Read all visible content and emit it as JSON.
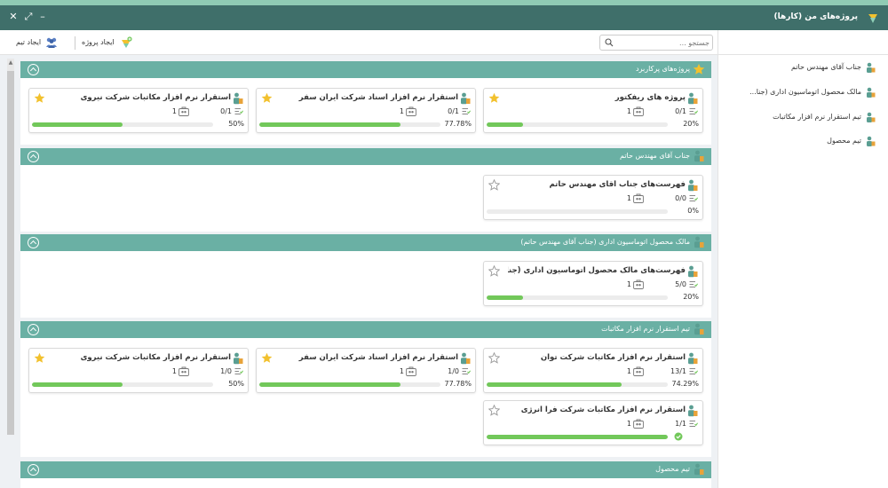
{
  "window": {
    "title": "پروژه‌های من (کارها)"
  },
  "toolbar": {
    "create_project_label": "ایجاد پروژه",
    "create_team_label": "ایجاد تیم",
    "search_placeholder": "جستجو ..."
  },
  "colors": {
    "header_teal": "#3f6f6a",
    "group_teal": "#6ab0a4",
    "progress_green": "#72c85a",
    "star_gold": "#f2c12e"
  },
  "sidebar": {
    "items": [
      {
        "label": "جناب آقای مهندس حاتم"
      },
      {
        "label": "مالک محصول اتوماسیون اداری (جنا..."
      },
      {
        "label": "تیم استقرار نرم افزار مکاتبات"
      },
      {
        "label": "تیم محصول"
      }
    ]
  },
  "groups": [
    {
      "title": "پروژه‌های پرکاربرد",
      "icon": "star-icon",
      "cards": [
        {
          "title": "پروژه های ریفکتور",
          "tasks_done": "0",
          "tasks_total": "1",
          "tasks": "0/1",
          "members": "1",
          "percent_label": "20%",
          "progress": 20,
          "starred": true
        },
        {
          "title": "استقرار نرم افزار اسناد شرکت ایران سفر",
          "tasks_done": "0",
          "tasks_total": "1",
          "tasks": "0/1",
          "members": "1",
          "percent_label": "77.78%",
          "progress": 77.78,
          "starred": true
        },
        {
          "title": "استقرار نرم افزار مکاتبات شرکت نیروی",
          "tasks_done": "0",
          "tasks_total": "1",
          "tasks": "0/1",
          "members": "1",
          "percent_label": "50%",
          "progress": 50,
          "starred": true
        }
      ]
    },
    {
      "title": "جناب آقای مهندس حاتم",
      "icon": "person-icon",
      "cards": [
        {
          "title": "فهرست‌های جناب آقای مهندس حاتم",
          "tasks": "0/0",
          "members": "1",
          "percent_label": "0%",
          "progress": 0,
          "starred": false
        }
      ]
    },
    {
      "title": "مالک محصول اتوماسیون اداری (جناب آقای مهندس حاتم)",
      "icon": "person-icon",
      "cards": [
        {
          "title": "فهرست‌های مالک محصول اتوماسیون اداری (جناب...",
          "tasks": "5/0",
          "members": "1",
          "percent_label": "20%",
          "progress": 20,
          "starred": false
        }
      ]
    },
    {
      "title": "تیم استقرار نرم افزار مکاتبات",
      "icon": "person-icon",
      "cards": [
        {
          "title": "استقرار نرم افزار مکاتبات شرکت توان",
          "tasks": "13/1",
          "members": "1",
          "percent_label": "74.29%",
          "progress": 74.29,
          "starred": false
        },
        {
          "title": "استقرار نرم افزار اسناد شرکت ایران سفر",
          "tasks": "1/0",
          "members": "1",
          "percent_label": "77.78%",
          "progress": 77.78,
          "starred": true
        },
        {
          "title": "استقرار نرم افزار مکاتبات شرکت نیروی",
          "tasks": "1/0",
          "members": "1",
          "percent_label": "50%",
          "progress": 50,
          "starred": true
        },
        {
          "title": "استقرار نرم افزار مکاتبات شرکت فرا انرژی",
          "tasks": "1/1",
          "members": "1",
          "percent_label": "",
          "progress": 100,
          "starred": false,
          "complete": true
        }
      ]
    },
    {
      "title": "تیم محصول",
      "icon": "person-icon",
      "cards": []
    }
  ]
}
